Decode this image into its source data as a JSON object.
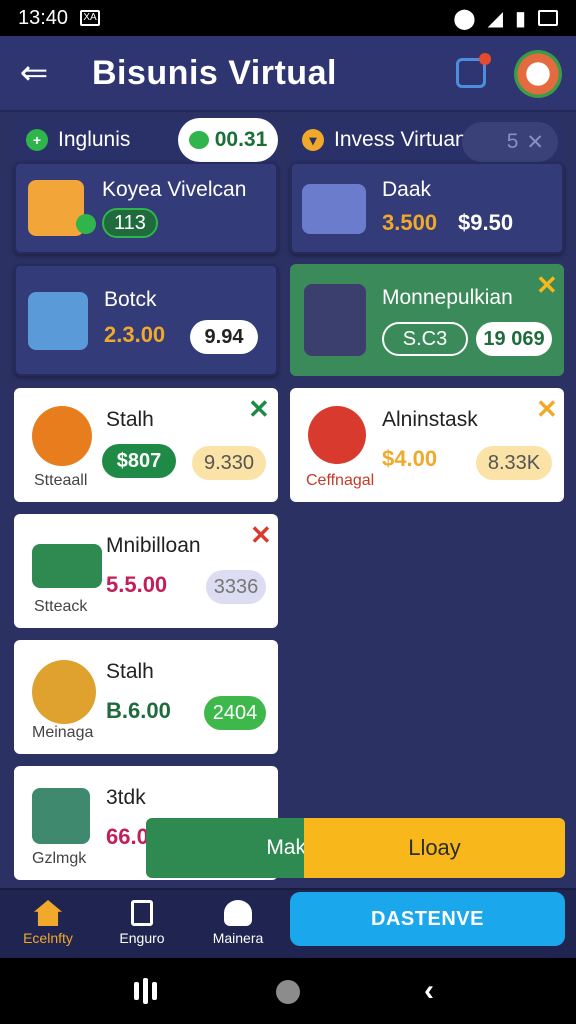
{
  "status": {
    "time": "13:40",
    "left_icon_text": "XA"
  },
  "header": {
    "title": "Bisunis Virtual"
  },
  "tabs": [
    {
      "label": "Inglunis",
      "timer": "00.31"
    },
    {
      "label": "Invess Virtuan",
      "badge": "5"
    }
  ],
  "cards": {
    "koyea": {
      "name": "Koyea Vivelcan",
      "pill": "113"
    },
    "daak": {
      "name": "Daak",
      "price": "3.500",
      "value": "$9.50"
    },
    "botck": {
      "name": "Botck",
      "price": "2.3.00",
      "pill": "9.94"
    },
    "monne": {
      "name": "Monnepulkian",
      "pill_left": "S.C3",
      "pill_right": "19 069"
    },
    "stalh1": {
      "name": "Stalh",
      "price": "$807",
      "pill": "9.330",
      "sub": "Stteaall"
    },
    "alnin": {
      "name": "Alninstask",
      "price": "$4.00",
      "pill": "8.33K",
      "sub": "Ceffnagal"
    },
    "mnib": {
      "name": "Mnibilloan",
      "price": "5.5.00",
      "pill": "3336",
      "sub": "Stteack"
    },
    "stalh2": {
      "name": "Stalh",
      "price": "B.6.00",
      "pill": "2404",
      "sub": "Meinaga"
    },
    "stdk": {
      "name": "3tdk",
      "price": "66.0",
      "sub": "Gzlmgk"
    }
  },
  "actions": {
    "green": "Mak",
    "yellow": "Lloay"
  },
  "nav": [
    {
      "label": "Ecelnfty"
    },
    {
      "label": "Enguro"
    },
    {
      "label": "Mainera"
    }
  ],
  "cta": {
    "label": "DASTENVE"
  },
  "colors": {
    "accent_green": "#2fb54b",
    "accent_yellow": "#f8b81b",
    "cta_blue": "#1aa7ec",
    "price_gold": "#f0a92a"
  }
}
